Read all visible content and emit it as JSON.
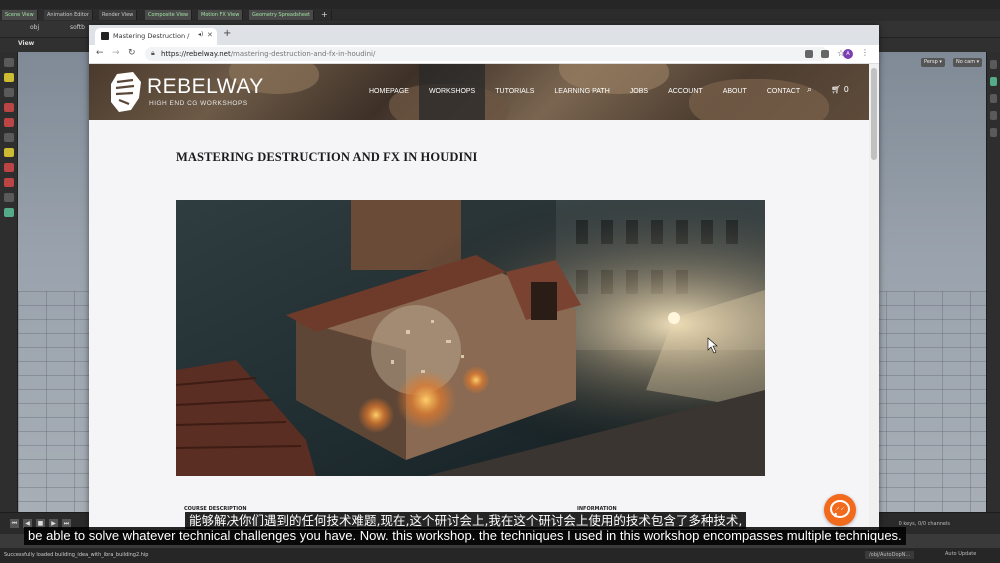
{
  "houdini": {
    "pane_tabs": [
      "Scene View",
      "Animation Editor",
      "Render View",
      "Composite View",
      "Motion FX View",
      "Geometry Spreadsheet"
    ],
    "toolbar": {
      "path_obj": "obj",
      "path_node": "softb"
    },
    "view_label": "View",
    "viewport_buttons": {
      "persp": "Persp ▾",
      "cam": "No cam ▾"
    },
    "timeline": {
      "keys_info": "0 keys, 0/0 channels"
    },
    "status": {
      "message": "Successfully loaded building_idea_with_ibra_building2.hip",
      "network_path": "/obj/AutoDopN...",
      "update_mode": "Auto Update"
    }
  },
  "browser": {
    "tab_title": "Mastering Destruction /",
    "url_host": "https://rebelway.net",
    "url_path": "/mastering-destruction-and-fx-in-houdini/",
    "profile_initial": "A"
  },
  "site": {
    "logo_text": "REBELWAY",
    "logo_sub": "HIGH END CG WORKSHOPS",
    "nav": [
      {
        "label": "HOMEPAGE"
      },
      {
        "label": "WORKSHOPS"
      },
      {
        "label": "TUTORIALS"
      },
      {
        "label": "LEARNING PATH"
      },
      {
        "label": "JOBS"
      },
      {
        "label": "ACCOUNT"
      },
      {
        "label": "ABOUT"
      },
      {
        "label": "CONTACT"
      }
    ],
    "active_nav": "WORKSHOPS",
    "cart_count": "0",
    "page_title": "MASTERING DESTRUCTION AND FX IN HOUDINI",
    "section_course": "COURSE DESCRIPTION",
    "section_info": "INFORMATION"
  },
  "subtitles": {
    "zh": "能够解决你们遇到的任何技术难题,现在,这个研讨会上,我在这个研讨会上使用的技术包含了多种技术,",
    "en": "be able to solve whatever technical challenges you have. Now. this workshop. the techniques I used in this workshop encompasses multiple techniques."
  },
  "colors": {
    "accent": "#f26b1d",
    "header_bg": "#5a4636",
    "profile": "#7b3fb0"
  }
}
